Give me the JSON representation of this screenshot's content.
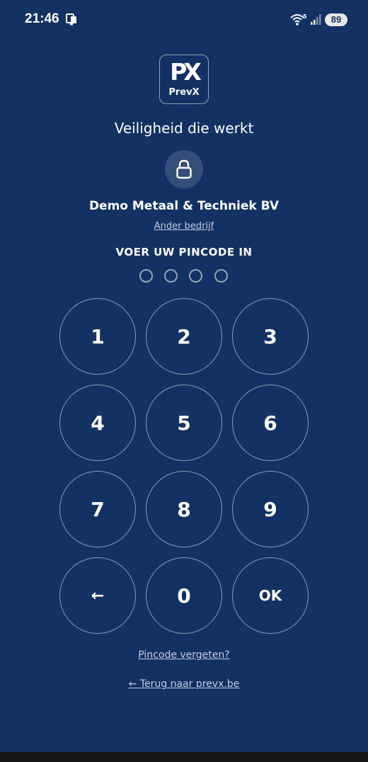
{
  "status_bar": {
    "time": "21:46",
    "battery": "89",
    "icons": [
      "notification-icon",
      "wifi-icon",
      "signal-icon",
      "battery-icon"
    ]
  },
  "logo": {
    "mark": "PX",
    "text": "PrevX"
  },
  "tagline": "Veiligheid die werkt",
  "lock_icon": "lock-icon",
  "company": {
    "name": "Demo Metaal & Techniek BV",
    "other_link": "Ander bedrijf"
  },
  "pin": {
    "label": "VOER UW PINCODE IN",
    "length": 4,
    "entered": 0
  },
  "keypad": {
    "keys": [
      "1",
      "2",
      "3",
      "4",
      "5",
      "6",
      "7",
      "8",
      "9",
      "←",
      "0",
      "OK"
    ]
  },
  "links": {
    "forgot": "Pincode vergeten?",
    "back": "← Terug naar prevx.be"
  },
  "colors": {
    "background": "#133163",
    "text": "#ffffff",
    "muted_link": "#c3cde0"
  }
}
